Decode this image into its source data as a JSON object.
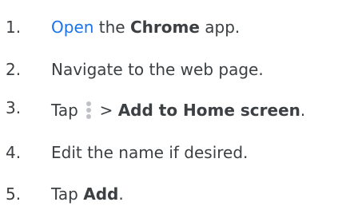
{
  "steps": [
    {
      "number": "1.",
      "link": "Open",
      "text_a": " the ",
      "bold": "Chrome",
      "text_b": " app."
    },
    {
      "number": "2.",
      "text": "Navigate to the web page."
    },
    {
      "number": "3.",
      "text_a": "Tap ",
      "icon": "more-vertical-icon",
      "text_b": " > ",
      "bold": "Add to Home screen",
      "text_c": "."
    },
    {
      "number": "4.",
      "text": "Edit the name if desired."
    },
    {
      "number": "5.",
      "text_a": "Tap ",
      "bold": "Add",
      "text_b": "."
    }
  ],
  "colors": {
    "text": "#3c4043",
    "link": "#1a73e8",
    "icon": "#bdc1c6"
  }
}
